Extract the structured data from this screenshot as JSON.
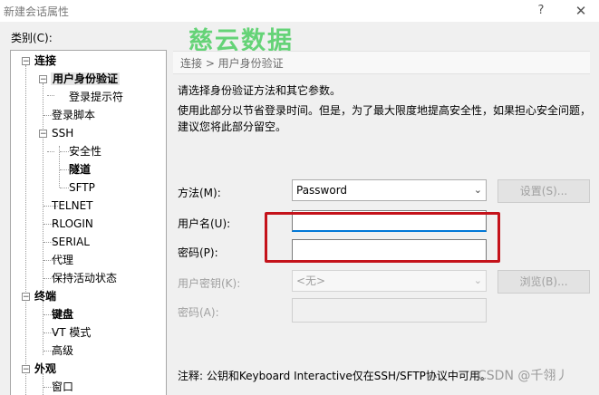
{
  "window": {
    "title": "新建会话属性",
    "help": "?",
    "close": "✕"
  },
  "watermark": "慈云数据",
  "category_label": "类别(C):",
  "tree": {
    "connection": "连接",
    "user_auth": "用户身份验证",
    "login_prompt": "登录提示符",
    "login_script": "登录脚本",
    "ssh": "SSH",
    "security": "安全性",
    "tunnel": "隧道",
    "sftp": "SFTP",
    "telnet": "TELNET",
    "rlogin": "RLOGIN",
    "serial": "SERIAL",
    "proxy": "代理",
    "keepalive": "保持活动状态",
    "terminal": "终端",
    "keyboard": "键盘",
    "vt_mode": "VT 模式",
    "advanced": "高级",
    "appearance": "外观",
    "window": "窗口"
  },
  "breadcrumb": "连接 > 用户身份验证",
  "intro": {
    "line1": "请选择身份验证方法和其它参数。",
    "line2": "使用此部分以节省登录时间。但是，为了最大限度地提高安全性，如果担心安全问题，",
    "line3": "建议您将此部分留空。"
  },
  "form": {
    "method_label": "方法(M):",
    "method_value": "Password",
    "settings_button": "设置(S)...",
    "username_label": "用户名(U):",
    "username_value": "",
    "password_label": "密码(P):",
    "password_value": "",
    "userkey_label": "用户密钥(K):",
    "userkey_value": "<无>",
    "browse_button": "浏览(B)...",
    "passphrase_label": "密码(A):",
    "passphrase_value": ""
  },
  "note": "注释: 公钥和Keyboard Interactive仅在SSH/SFTP协议中可用。",
  "credit": "CSDN @千翎丿",
  "colors": {
    "highlight_box": "#c4121a",
    "watermark": "#57d06b",
    "focus": "#0078d7"
  }
}
